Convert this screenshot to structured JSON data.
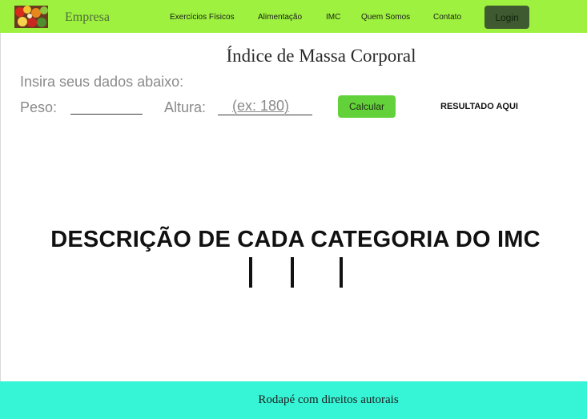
{
  "header": {
    "brand": "Empresa",
    "nav": [
      {
        "label": "Exercícios Físicos"
      },
      {
        "label": "Alimentação"
      },
      {
        "label": "IMC"
      },
      {
        "label": "Quem Somos"
      },
      {
        "label": "Contato"
      }
    ],
    "login_label": "Login"
  },
  "main": {
    "title": "Índice de Massa Corporal",
    "subtitle": "Insira seus dados abaixo:",
    "weight_label": "Peso:",
    "weight_value": "",
    "height_label": "Altura:",
    "height_placeholder": "(ex: 180)",
    "calculate_label": "Calcular",
    "result_text": "RESULTADO AQUI",
    "categories_heading": "DESCRIÇÃO DE CADA CATEGORIA DO IMC"
  },
  "footer": {
    "text": "Rodapé com direitos autorais"
  },
  "colors": {
    "header_bg": "#9ef23f",
    "login_bg": "#3f5a31",
    "calculate_bg": "#63d23a",
    "footer_bg": "#35f5d6"
  }
}
